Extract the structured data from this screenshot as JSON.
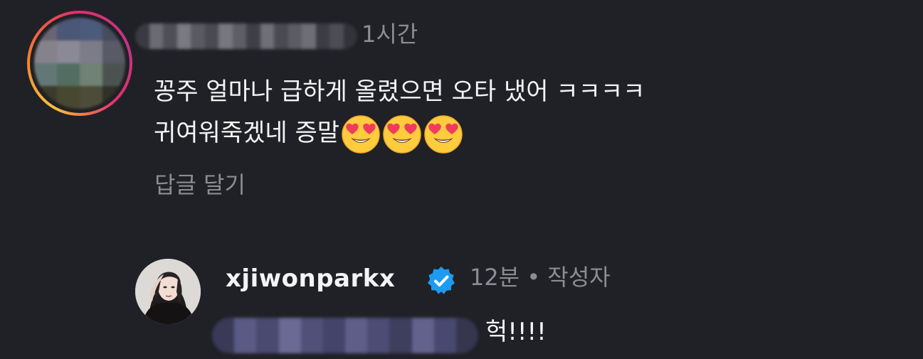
{
  "comment": {
    "time": "1시간",
    "line1": "꽁주 얼마나 급하게 올렸으면 오타 냈어 ㅋㅋㅋㅋ",
    "line2": "귀여워죽겠네 증말",
    "emoji": "smiling-face-with-heart-eyes",
    "emoji_count": 3,
    "reply_label": "답글 달기"
  },
  "reply": {
    "username": "xjiwonparkx",
    "verified": true,
    "meta": "12분 • 작성자",
    "text": "헉!!!!"
  },
  "colors": {
    "background": "#202126",
    "primary_text": "#f4f4f6",
    "secondary_text": "#8b8d93",
    "verified_badge": "#1d9bf0"
  }
}
